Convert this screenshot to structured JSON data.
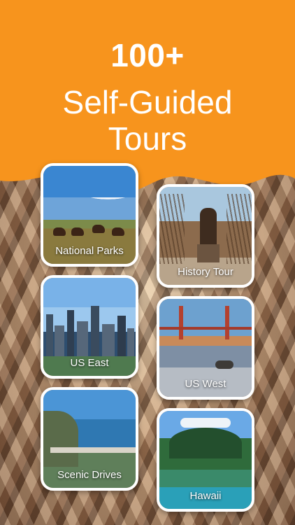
{
  "header": {
    "count": "100+",
    "subtitle_line1": "Self-Guided",
    "subtitle_line2": "Tours",
    "color": "#F7941D"
  },
  "cards": [
    {
      "label": "National Parks",
      "icon": "bison-prairie-photo"
    },
    {
      "label": "History Tour",
      "icon": "statue-photo"
    },
    {
      "label": "US East",
      "icon": "city-skyline-photo"
    },
    {
      "label": "US West",
      "icon": "golden-gate-bridge-photo"
    },
    {
      "label": "Scenic Drives",
      "icon": "coastal-bridge-photo"
    },
    {
      "label": "Hawaii",
      "icon": "tropical-island-photo"
    }
  ]
}
